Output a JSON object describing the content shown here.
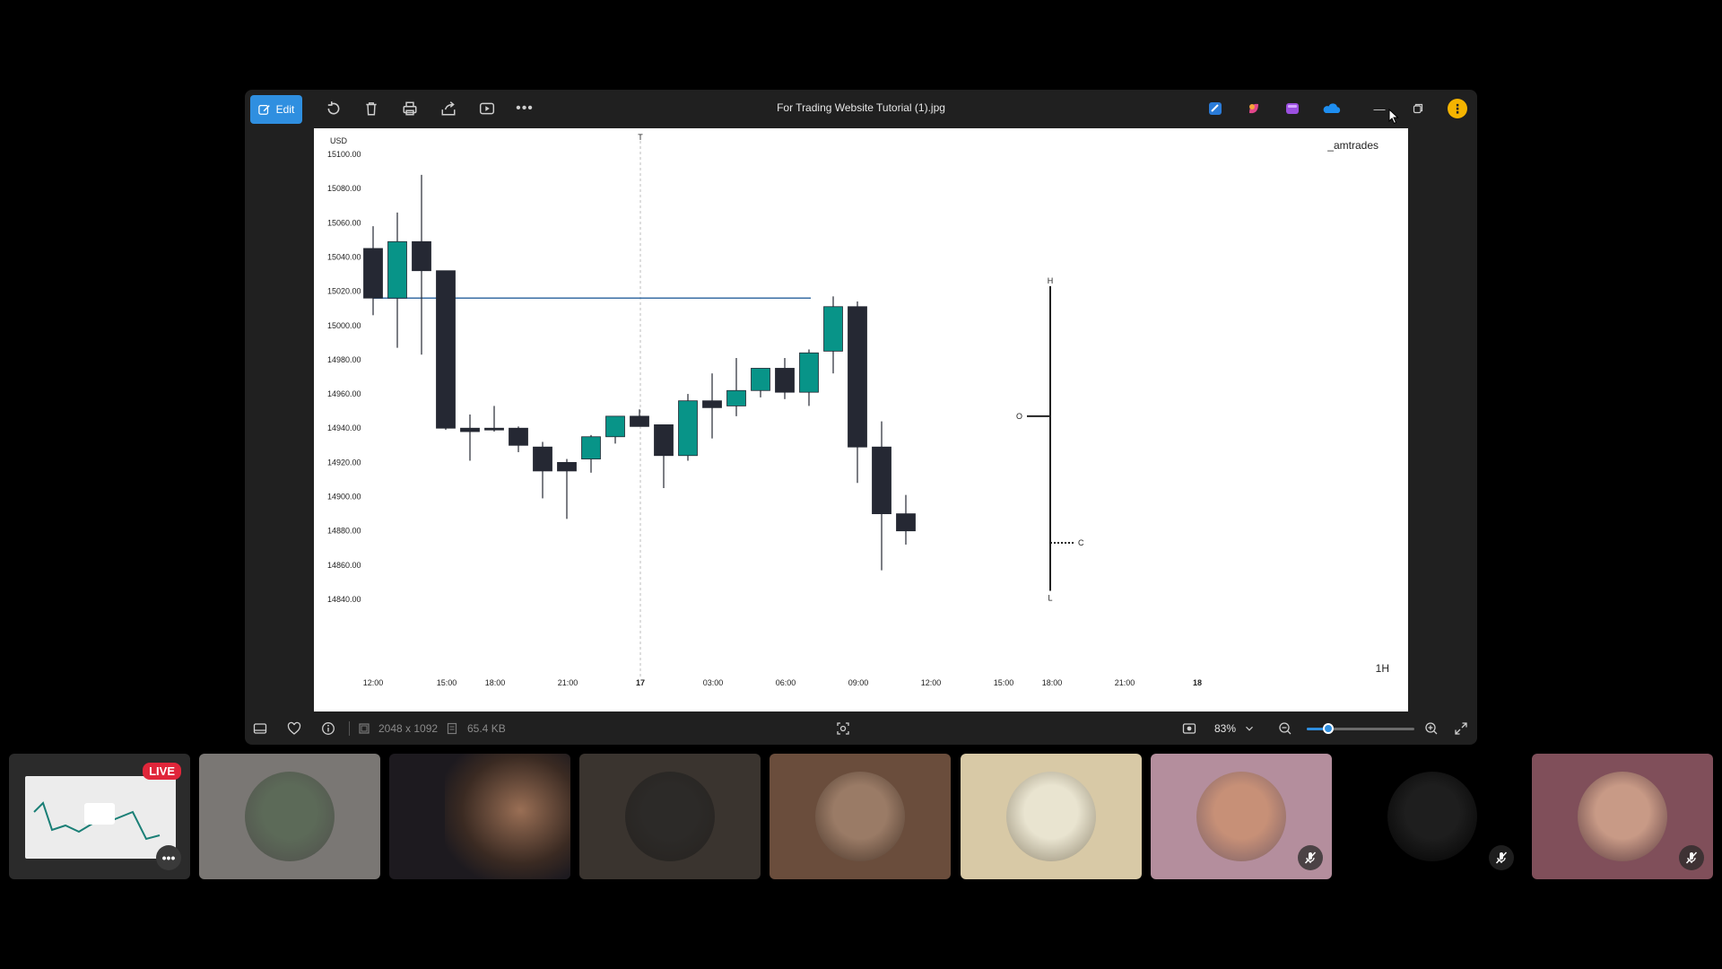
{
  "window": {
    "title": "For Trading Website Tutorial (1).jpg",
    "edit_label": "Edit",
    "toolbar_icons": [
      "rotate-icon",
      "delete-icon",
      "print-icon",
      "share-icon",
      "slideshow-icon",
      "more-icon"
    ],
    "app_icons": [
      "clipchamp-icon",
      "copilot-icon",
      "designer-icon",
      "onedrive-icon"
    ]
  },
  "status": {
    "dimensions": "2048 x 1092",
    "size": "65.4 KB",
    "zoom": "83%",
    "zoom_level": 0.2
  },
  "chart_data": {
    "type": "candlestick",
    "currency_label": "USD",
    "watermark": "_amtrades",
    "timeframe": "1H",
    "ylim": [
      14840,
      15100
    ],
    "yticks": [
      "15100.00",
      "15080.00",
      "15060.00",
      "15040.00",
      "15020.00",
      "15000.00",
      "14980.00",
      "14960.00",
      "14940.00",
      "14920.00",
      "14900.00",
      "14880.00",
      "14860.00",
      "14840.00"
    ],
    "xticks": [
      "12:00",
      "15:00",
      "18:00",
      "21:00",
      "17",
      "03:00",
      "06:00",
      "09:00",
      "12:00",
      "15:00",
      "18:00",
      "21:00",
      "18"
    ],
    "horizontal_line": 15016,
    "vertical_marker_label": "T",
    "candles": [
      {
        "o": 15016,
        "h": 15058,
        "l": 15006,
        "c": 15045,
        "dir": "down"
      },
      {
        "o": 15016,
        "h": 15066,
        "l": 14987,
        "c": 15049,
        "dir": "up"
      },
      {
        "o": 15049,
        "h": 15088,
        "l": 14983,
        "c": 15032,
        "dir": "down"
      },
      {
        "o": 15032,
        "h": 15032,
        "l": 14939,
        "c": 14940,
        "dir": "down"
      },
      {
        "o": 14940,
        "h": 14948,
        "l": 14921,
        "c": 14938,
        "dir": "down"
      },
      {
        "o": 14940,
        "h": 14953,
        "l": 14938,
        "c": 14940,
        "dir": "down"
      },
      {
        "o": 14940,
        "h": 14941,
        "l": 14926,
        "c": 14930,
        "dir": "down"
      },
      {
        "o": 14929,
        "h": 14932,
        "l": 14899,
        "c": 14915,
        "dir": "down"
      },
      {
        "o": 14920,
        "h": 14922,
        "l": 14887,
        "c": 14915,
        "dir": "down"
      },
      {
        "o": 14922,
        "h": 14936,
        "l": 14914,
        "c": 14935,
        "dir": "up"
      },
      {
        "o": 14935,
        "h": 14947,
        "l": 14931,
        "c": 14947,
        "dir": "up"
      },
      {
        "o": 14947,
        "h": 14951,
        "l": 14941,
        "c": 14941,
        "dir": "down"
      },
      {
        "o": 14942,
        "h": 14942,
        "l": 14905,
        "c": 14924,
        "dir": "down"
      },
      {
        "o": 14924,
        "h": 14960,
        "l": 14921,
        "c": 14956,
        "dir": "up"
      },
      {
        "o": 14956,
        "h": 14972,
        "l": 14934,
        "c": 14952,
        "dir": "down"
      },
      {
        "o": 14953,
        "h": 14981,
        "l": 14947,
        "c": 14962,
        "dir": "up"
      },
      {
        "o": 14962,
        "h": 14975,
        "l": 14958,
        "c": 14975,
        "dir": "up"
      },
      {
        "o": 14975,
        "h": 14981,
        "l": 14957,
        "c": 14961,
        "dir": "down"
      },
      {
        "o": 14961,
        "h": 14986,
        "l": 14953,
        "c": 14984,
        "dir": "up"
      },
      {
        "o": 14985,
        "h": 15017,
        "l": 14972,
        "c": 15011,
        "dir": "up"
      },
      {
        "o": 15011,
        "h": 15014,
        "l": 14908,
        "c": 14929,
        "dir": "down"
      },
      {
        "o": 14929,
        "h": 14944,
        "l": 14857,
        "c": 14890,
        "dir": "down"
      },
      {
        "o": 14890,
        "h": 14901,
        "l": 14872,
        "c": 14880,
        "dir": "down"
      }
    ],
    "ohlc_legend": {
      "h_label": "H",
      "o_label": "O",
      "l_label": "L",
      "c_label": "C",
      "h": 15023,
      "o": 14947,
      "l": 14845,
      "c": 14873
    }
  },
  "participants": [
    {
      "kind": "screen",
      "live_label": "LIVE",
      "bg": "#2b2b2b"
    },
    {
      "kind": "avatar",
      "bg": "#7a7774",
      "muted": false,
      "tone": "#5c6a58"
    },
    {
      "kind": "camera",
      "bg": "#1d1a1f",
      "muted": false,
      "tone": "#9a6f55"
    },
    {
      "kind": "avatar",
      "bg": "#3a342f",
      "muted": false,
      "tone": "#2c2a28"
    },
    {
      "kind": "avatar",
      "bg": "#6a4d3c",
      "muted": false,
      "tone": "#9a7b66"
    },
    {
      "kind": "avatar",
      "bg": "#d8c9a6",
      "muted": false,
      "tone": "#e9e4d0"
    },
    {
      "kind": "avatar",
      "bg": "#b48e9d",
      "muted": true,
      "tone": "#c79077"
    },
    {
      "kind": "avatar",
      "bg": "#000000",
      "muted": true,
      "tone": "#1e1e1e"
    },
    {
      "kind": "avatar",
      "bg": "#804f5a",
      "muted": true,
      "tone": "#c89a86"
    }
  ]
}
